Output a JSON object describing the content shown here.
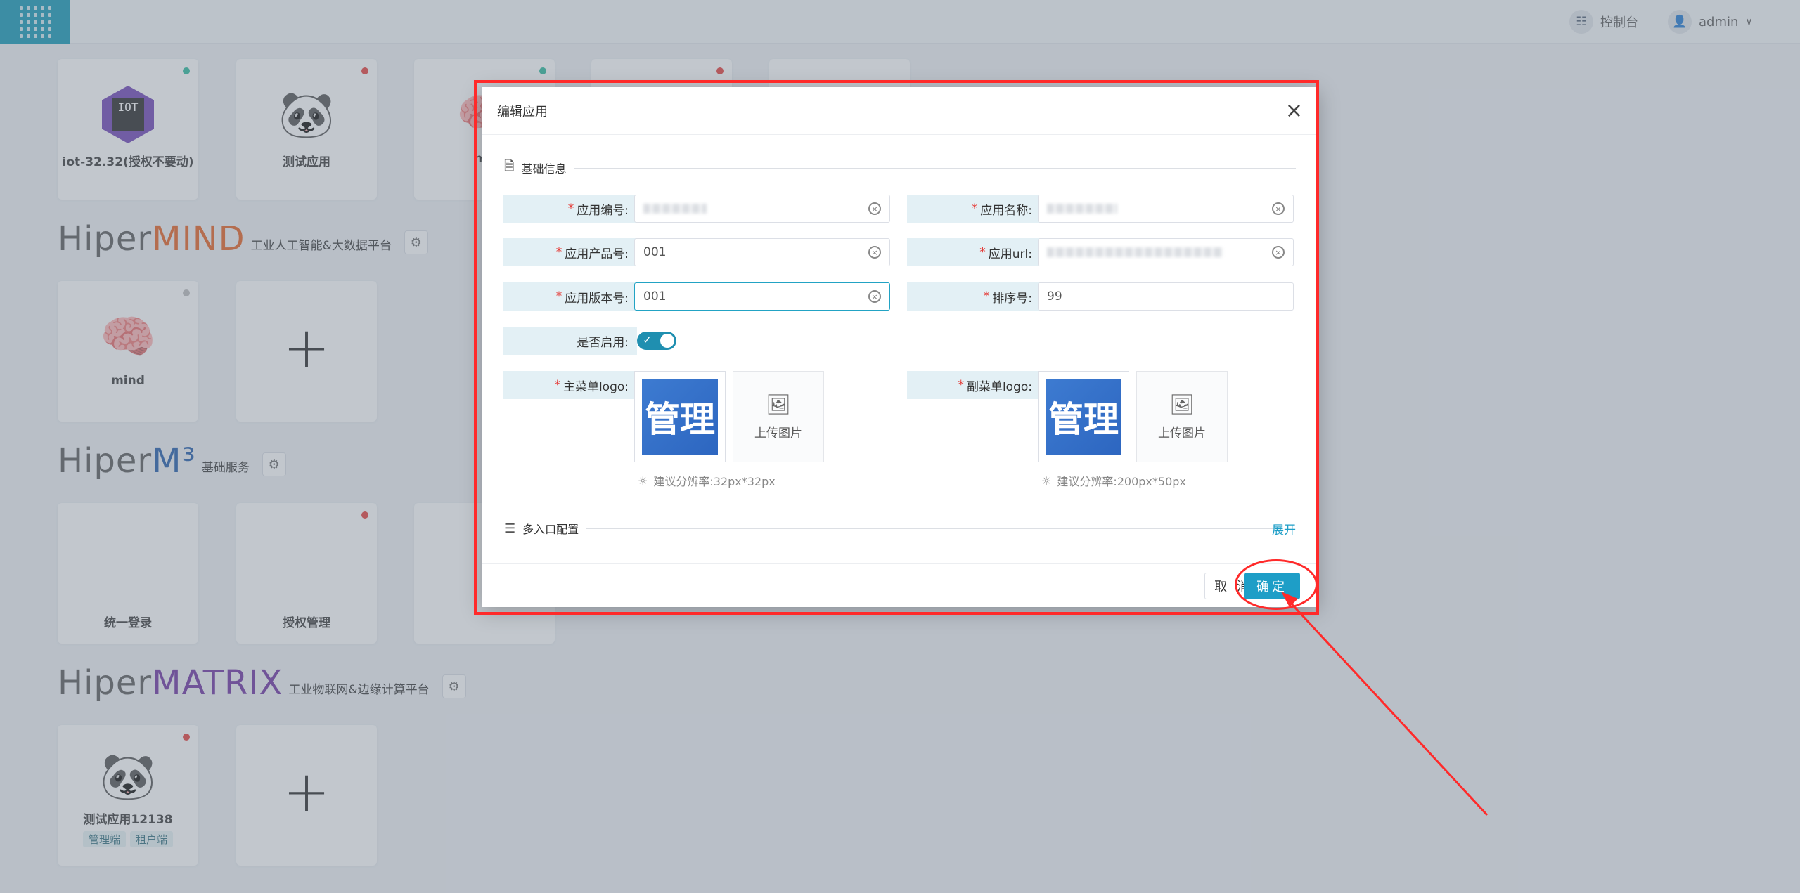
{
  "topbar": {
    "console_label": "控制台",
    "user_label": "admin"
  },
  "cards_row1": [
    {
      "name": "iot-32.32(授权不要动)",
      "status_color": "#26b89a"
    },
    {
      "name": "测试应用",
      "status_color": "#e53935"
    },
    {
      "name": "ma",
      "status_color": "#26b89a"
    },
    {
      "name": "",
      "status_color": "#e53935"
    }
  ],
  "sections": {
    "mind": {
      "prefix": "Hiper",
      "suffix": "MIND",
      "subtitle": "工业人工智能&大数据平台",
      "accent": "#e65c1b"
    },
    "m3": {
      "prefix": "Hiper",
      "suffix": "M³",
      "subtitle": "基础服务",
      "accent": "#1b56a8"
    },
    "matrix": {
      "prefix": "Hiper",
      "suffix": "MATRIX",
      "subtitle": "工业物联网&边缘计算平台",
      "accent": "#6a2d9e"
    }
  },
  "cards_mind": [
    {
      "name": "mind",
      "status_color": "#bbbbbb"
    }
  ],
  "cards_m3": [
    {
      "name": "统一登录"
    },
    {
      "name": "授权管理",
      "status_color": "#e53935"
    }
  ],
  "cards_matrix": [
    {
      "name": "测试应用12138",
      "status_color": "#e53935",
      "tags": [
        "管理端",
        "租户端"
      ]
    }
  ],
  "modal": {
    "title": "编辑应用",
    "section_basic": "基础信息",
    "fields": {
      "app_code": {
        "label": "应用编号:",
        "value": ""
      },
      "app_name": {
        "label": "应用名称:",
        "value": ""
      },
      "product_no": {
        "label": "应用产品号:",
        "value": "001"
      },
      "app_url": {
        "label": "应用url:",
        "value": ""
      },
      "version_no": {
        "label": "应用版本号:",
        "value": "001"
      },
      "sort_no": {
        "label": "排序号:",
        "value": "99"
      },
      "enabled": {
        "label": "是否启用:",
        "on": true
      },
      "main_logo": {
        "label": "主菜单logo:",
        "image_text": "管理",
        "upload_label": "上传图片",
        "hint": "建议分辨率:32px*32px"
      },
      "sub_logo": {
        "label": "副菜单logo:",
        "image_text": "管理",
        "upload_label": "上传图片",
        "hint": "建议分辨率:200px*50px"
      }
    },
    "section_multi": "多入口配置",
    "expand_label": "展开",
    "cancel_label": "取 消",
    "ok_label": "确定"
  },
  "annotation_color": "#ff2a2a"
}
